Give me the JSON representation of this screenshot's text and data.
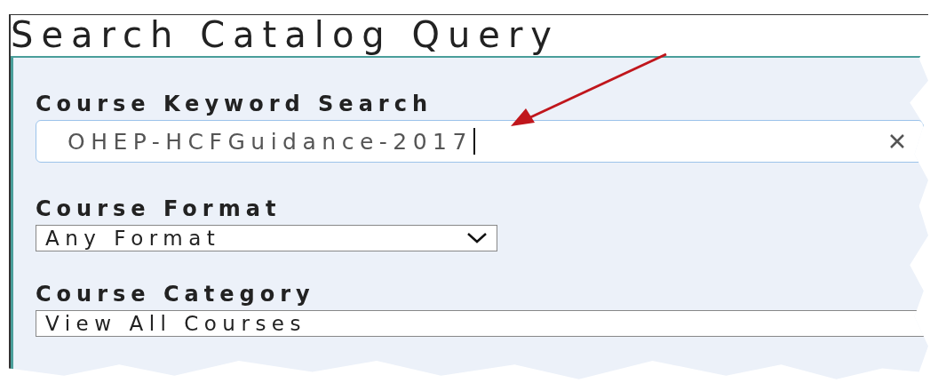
{
  "title": "Search Catalog Query",
  "keyword_search": {
    "label": "Course Keyword Search",
    "value": "OHEP-HCFGuidance-2017"
  },
  "course_format": {
    "label": "Course Format",
    "value": "Any Format"
  },
  "course_category": {
    "label": "Course Category",
    "value": "View All Courses"
  }
}
